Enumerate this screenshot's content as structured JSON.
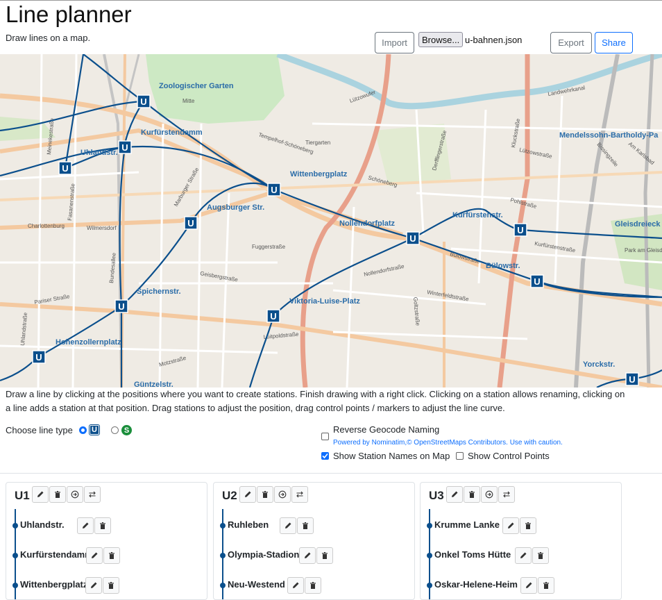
{
  "app": {
    "title": "Line planner",
    "subtitle": "Draw lines on a map.",
    "import_label": "Import",
    "browse_label": "Browse...",
    "file_name": "u-bahnen.json",
    "export_label": "Export",
    "share_label": "Share"
  },
  "map": {
    "labels": {
      "zoo": "Zoologischer Garten",
      "kudamm": "Kurfürstendamm",
      "uhland": "Uhlandstr.",
      "wittenberg": "Wittenbergplatz",
      "augsburger": "Augsburger Str.",
      "nollendorf": "Nollendorfplatz",
      "kurfuersten": "Kurfürstenstr.",
      "gleisdreieck": "Gleisdreieck",
      "mendelssohn": "Mendelssohn-Bartholdy-Pa",
      "bulowstr": "Bülowstr.",
      "spichern": "Spichernstr.",
      "viktoria": "Viktoria-Luise-Platz",
      "hohenzollern": "Hohenzollernplatz",
      "guentzel": "Güntzelstr.",
      "yorck": "Yorckstr."
    },
    "streets": {
      "lutzowufer": "Lützowufer",
      "tiergarten": "Tiergarten",
      "tempelhof": "Tempelhof-Schöneberg",
      "charlottenburg": "Charlottenburg",
      "marburger": "Marburger Straße",
      "fuggerstr": "Fuggerstraße",
      "nollendorfstr": "Nollendorfstraße",
      "winterfeldt": "Winterfeldtstraße",
      "bulowstrasse": "Bülowstraße",
      "kurfuerstenstrasse": "Kurfürstenstraße",
      "pohlstr": "Pohlstraße",
      "luetzowstr": "Lützowstraße",
      "derfflinger": "Derfflingerstraße",
      "kluckstr": "Kluckstraße",
      "geisberg": "Geisbergstraße",
      "motzstr": "Motzstraße",
      "pariser": "Pariser Straße",
      "uhlandstrasse": "Uhlandstraße",
      "meinekestr": "Meinekestraße",
      "fasanenstr": "Fasanenstraße",
      "wilmersdorf": "Wilmersdorf",
      "bundesallee": "Bundesallee",
      "luitpold": "Luitpoldstraße",
      "goltzstr": "Goltzstraße",
      "schoeneberg": "Schöneberg",
      "park": "Park am Gleisdreieck - Westpark",
      "landwehr": "Landwehrkanal",
      "bissingzeile": "Bissingzeile",
      "karlsbad": "Am Karlsbad",
      "mitte": "Mitte"
    }
  },
  "help": {
    "text": "Draw a line by clicking at the positions where you want to create stations. Finish drawing with a right click. Clicking on a station allows renaming, clicking on a line adds a station at that position. Drag stations to adjust the position, drag control points / markers to adjust the line curve."
  },
  "options": {
    "line_type_label": "Choose line type",
    "u_glyph": "U",
    "s_glyph": "S",
    "reverse_geocode_label": "Reverse Geocode Naming",
    "powered_by": "Powered by Nominatim,© OpenStreetMaps Contributors. Use with caution.",
    "show_station_names_label": "Show Station Names on Map",
    "show_control_points_label": "Show Control Points"
  },
  "lines": [
    {
      "name": "U1",
      "stations": [
        "Uhlandstr.",
        "Kurfürstendamm",
        "Wittenbergplatz"
      ]
    },
    {
      "name": "U2",
      "stations": [
        "Ruhleben",
        "Olympia-Stadion",
        "Neu-Westend"
      ]
    },
    {
      "name": "U3",
      "stations": [
        "Krumme Lanke",
        "Onkel Toms Hütte",
        "Oskar-Helene-Heim"
      ]
    }
  ],
  "colors": {
    "line_blue": "#0b4f8c",
    "map_bg": "#f2efe9",
    "accent": "#0d6efd",
    "s_green": "#1a8e3b"
  }
}
